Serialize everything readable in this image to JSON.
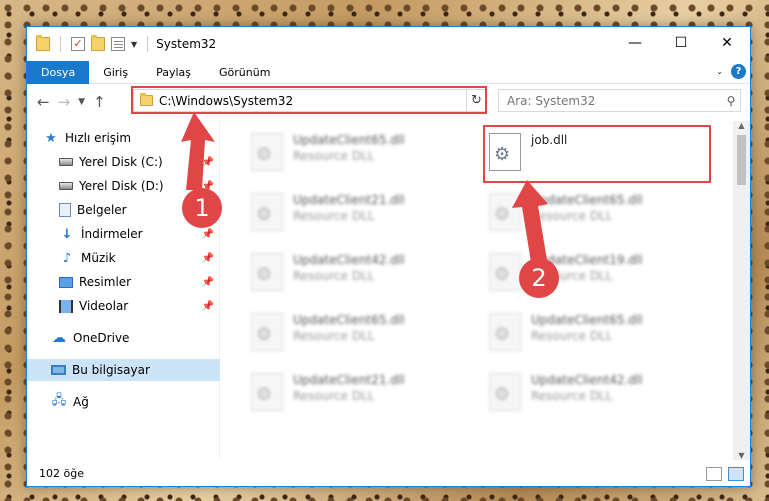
{
  "window": {
    "title": "System32"
  },
  "window_controls": {
    "minimize": "—",
    "maximize": "☐",
    "close": "✕"
  },
  "ribbon": {
    "tabs": [
      "Dosya",
      "Giriş",
      "Paylaş",
      "Görünüm"
    ],
    "help": "?"
  },
  "address": {
    "path": "C:\\Windows\\System32",
    "search_placeholder": "Ara: System32"
  },
  "sidebar": {
    "items": [
      {
        "label": "Hızlı erişim",
        "icon": "star-icon"
      },
      {
        "label": "Yerel Disk (C:)",
        "icon": "drive-icon",
        "pinned": true
      },
      {
        "label": "Yerel Disk (D:)",
        "icon": "drive-icon",
        "pinned": true
      },
      {
        "label": "Belgeler",
        "icon": "documents-icon",
        "pinned": true
      },
      {
        "label": "İndirmeler",
        "icon": "downloads-icon",
        "pinned": true
      },
      {
        "label": "Müzik",
        "icon": "music-icon",
        "pinned": true
      },
      {
        "label": "Resimler",
        "icon": "pictures-icon",
        "pinned": true
      },
      {
        "label": "Videolar",
        "icon": "videos-icon",
        "pinned": true
      },
      {
        "label": "OneDrive",
        "icon": "onedrive-icon"
      },
      {
        "label": "Bu bilgisayar",
        "icon": "this-pc-icon",
        "selected": true
      },
      {
        "label": "Ağ",
        "icon": "network-icon"
      }
    ]
  },
  "files": [
    {
      "name": "UpdateClient65.dll",
      "desc": "Resource DLL"
    },
    {
      "name": "job.dll",
      "desc": ""
    },
    {
      "name": "UpdateClient21.dll",
      "desc": "Resource DLL"
    },
    {
      "name": "UpdateClient65.dll",
      "desc": "Resource DLL"
    },
    {
      "name": "UpdateClient42.dll",
      "desc": "Resource DLL"
    },
    {
      "name": "UpdateClient19.dll",
      "desc": "Resource DLL"
    },
    {
      "name": "UpdateClient65.dll",
      "desc": "Resource DLL"
    },
    {
      "name": "UpdateClient65.dll",
      "desc": "Resource DLL"
    },
    {
      "name": "UpdateClient21.dll",
      "desc": "Resource DLL"
    },
    {
      "name": "UpdateClient42.dll",
      "desc": "Resource DLL"
    }
  ],
  "status": {
    "count": "102 öğe"
  },
  "annotations": {
    "marker1": "1",
    "marker2": "2",
    "color": "#e04646"
  }
}
